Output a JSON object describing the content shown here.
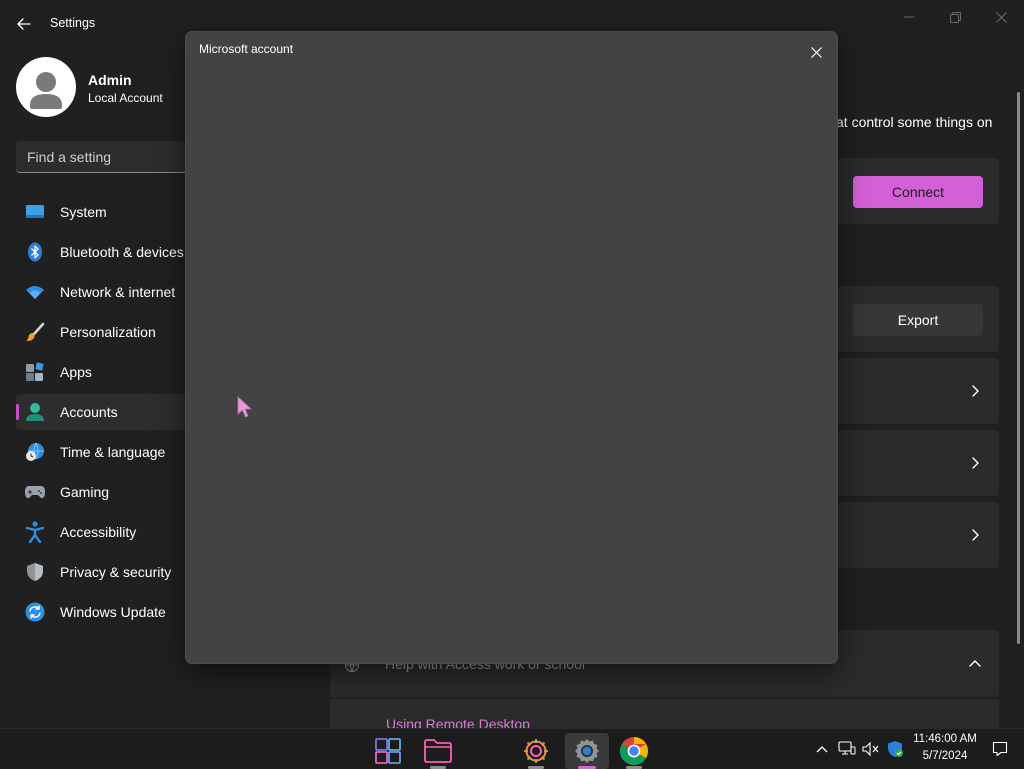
{
  "window": {
    "title": "Settings",
    "back_icon": "back-arrow-icon",
    "minimize_icon": "minimize-icon",
    "maximize_icon": "restore-icon",
    "close_icon": "close-icon"
  },
  "profile": {
    "name": "Admin",
    "account_type": "Local Account",
    "avatar_icon": "user-avatar-icon"
  },
  "search": {
    "placeholder": "Find a setting"
  },
  "sidebar": {
    "items": [
      {
        "label": "System",
        "icon": "system-icon"
      },
      {
        "label": "Bluetooth & devices",
        "icon": "bluetooth-icon"
      },
      {
        "label": "Network & internet",
        "icon": "wifi-icon"
      },
      {
        "label": "Personalization",
        "icon": "paintbrush-icon"
      },
      {
        "label": "Apps",
        "icon": "apps-icon"
      },
      {
        "label": "Accounts",
        "icon": "accounts-icon",
        "selected": true
      },
      {
        "label": "Time & language",
        "icon": "globe-clock-icon"
      },
      {
        "label": "Gaming",
        "icon": "gamepad-icon"
      },
      {
        "label": "Accessibility",
        "icon": "accessibility-icon"
      },
      {
        "label": "Privacy & security",
        "icon": "shield-icon"
      },
      {
        "label": "Windows Update",
        "icon": "update-icon"
      }
    ]
  },
  "main": {
    "partial_text": "at control some things on",
    "connect_label": "Connect",
    "export_label": "Export",
    "help_section_label": "Help with Access work or school",
    "remote_desktop_link": "Using Remote Desktop"
  },
  "dialog": {
    "title": "Microsoft account",
    "close_icon": "close-icon"
  },
  "taskbar": {
    "apps": [
      "start-icon",
      "file-explorer-icon",
      "settings-gear-icon",
      "settings-active-icon",
      "chrome-icon"
    ],
    "time": "11:46:00 AM",
    "date": "5/7/2024"
  },
  "colors": {
    "accent": "#d460d8",
    "background": "#202020",
    "dialog_background": "#434343",
    "card_background": "#2b2b2b"
  }
}
